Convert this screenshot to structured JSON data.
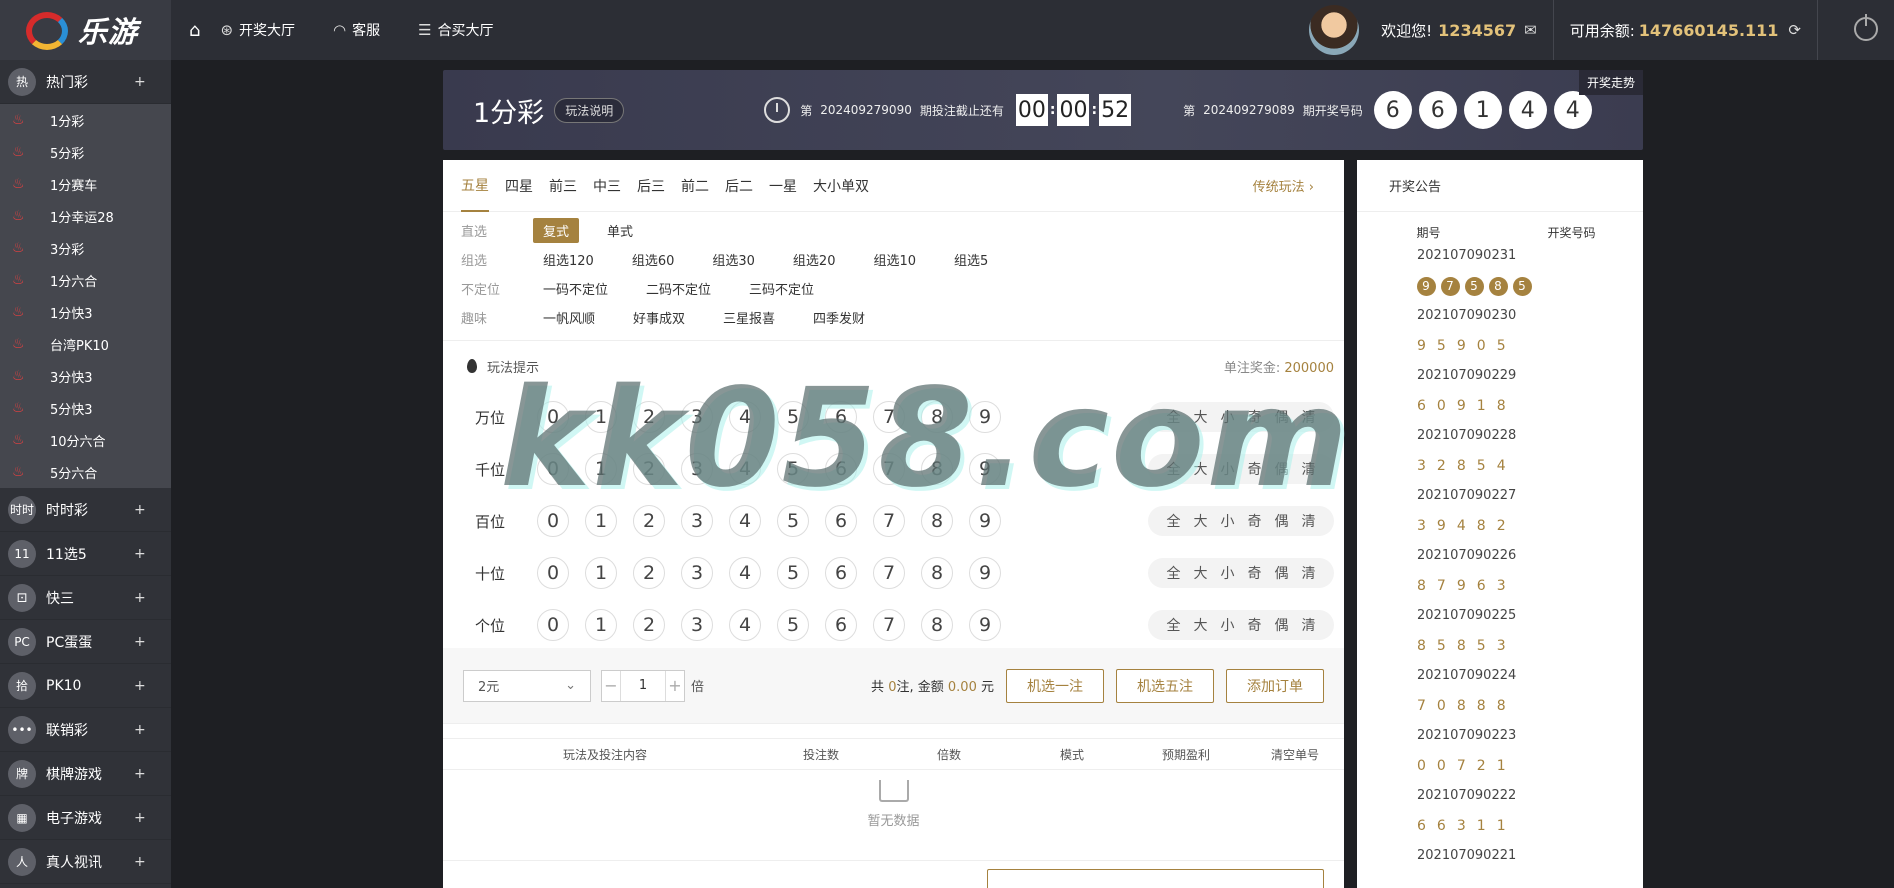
{
  "brand": {
    "name": "乐游"
  },
  "topnav": {
    "items": [
      {
        "label": "开奖大厅",
        "icon": "trophy-icon"
      },
      {
        "label": "客服",
        "icon": "headset-icon"
      },
      {
        "label": "合买大厅",
        "icon": "list-icon"
      }
    ]
  },
  "user": {
    "welcome": "欢迎您!",
    "name": "1234567",
    "balance_label": "可用余额:",
    "balance": "147660145.111"
  },
  "sidebar": {
    "hot": {
      "label": "热门彩",
      "expand": "+",
      "items": [
        "1分彩",
        "5分彩",
        "1分赛车",
        "1分幸运28",
        "3分彩",
        "1分六合",
        "1分快3",
        "台湾PK10",
        "3分快3",
        "5分快3",
        "10分六合",
        "5分六合"
      ]
    },
    "categories": [
      {
        "label": "时时彩",
        "icon_text": "时时",
        "expand": "+"
      },
      {
        "label": "11选5",
        "icon_text": "11",
        "expand": "+"
      },
      {
        "label": "快三",
        "icon_text": "⚀",
        "expand": "+"
      },
      {
        "label": "PC蛋蛋",
        "icon_text": "PC",
        "expand": "+"
      },
      {
        "label": "PK10",
        "icon_text": "拾",
        "expand": "+"
      },
      {
        "label": "联销彩",
        "icon_text": "•••",
        "expand": "+"
      },
      {
        "label": "棋牌游戏",
        "icon_text": "牌",
        "expand": "+"
      },
      {
        "label": "电子游戏",
        "icon_text": "▦",
        "expand": "+"
      },
      {
        "label": "真人视讯",
        "icon_text": "人",
        "expand": "+"
      }
    ]
  },
  "banner": {
    "game_name": "1分彩",
    "rule_label": "玩法说明",
    "current_prefix": "第",
    "current_issue": "202409279090",
    "deadline_text": "期投注截止还有",
    "countdown": [
      "00",
      "00",
      "52"
    ],
    "last_prefix": "第",
    "last_issue": "202409279089",
    "last_text": "期开奖号码",
    "last_numbers": [
      "6",
      "6",
      "1",
      "4",
      "4"
    ],
    "trend_label": "开奖走势"
  },
  "tabs": {
    "items": [
      "五星",
      "四星",
      "前三",
      "中三",
      "后三",
      "前二",
      "后二",
      "一星",
      "大小单双"
    ],
    "active": 0,
    "traditional": "传统玩法 ›"
  },
  "methods": [
    {
      "label": "直选",
      "options": [
        "复式",
        "单式"
      ],
      "selected": 0
    },
    {
      "label": "组选",
      "options": [
        "组选120",
        "组选60",
        "组选30",
        "组选20",
        "组选10",
        "组选5"
      ],
      "selected": -1
    },
    {
      "label": "不定位",
      "options": [
        "一码不定位",
        "二码不定位",
        "三码不定位"
      ],
      "selected": -1
    },
    {
      "label": "趣味",
      "options": [
        "一帆风顺",
        "好事成双",
        "三星报喜",
        "四季发财"
      ],
      "selected": -1
    }
  ],
  "hint": {
    "label": "玩法提示",
    "prize_label": "单注奖金:",
    "prize_value": "200000"
  },
  "positions": [
    "万位",
    "千位",
    "百位",
    "十位",
    "个位"
  ],
  "digits": [
    "0",
    "1",
    "2",
    "3",
    "4",
    "5",
    "6",
    "7",
    "8",
    "9"
  ],
  "quick": [
    "全",
    "大",
    "小",
    "奇",
    "偶",
    "清"
  ],
  "betbar": {
    "unit": "2元",
    "multiple": "1",
    "times_label": "倍",
    "sum_prefix": "共",
    "sum_count": "0",
    "sum_mid": "注, 金额",
    "sum_amount": "0.00",
    "sum_unit": "元",
    "buttons": [
      "机选一注",
      "机选五注",
      "添加订单"
    ]
  },
  "order_head": [
    "玩法及投注内容",
    "投注数",
    "倍数",
    "模式",
    "预期盈利",
    "清空单号"
  ],
  "empty_text": "暂无数据",
  "results": {
    "title": "开奖公告",
    "col_issue": "期号",
    "col_numbers": "开奖号码",
    "rows": [
      {
        "issue": "202107090231",
        "numbers": [
          "9",
          "7",
          "5",
          "8",
          "5"
        ]
      },
      {
        "issue": "202107090230",
        "numbers": [
          "9",
          "5",
          "9",
          "0",
          "5"
        ]
      },
      {
        "issue": "202107090229",
        "numbers": [
          "6",
          "0",
          "9",
          "1",
          "8"
        ]
      },
      {
        "issue": "202107090228",
        "numbers": [
          "3",
          "2",
          "8",
          "5",
          "4"
        ]
      },
      {
        "issue": "202107090227",
        "numbers": [
          "3",
          "9",
          "4",
          "8",
          "2"
        ]
      },
      {
        "issue": "202107090226",
        "numbers": [
          "8",
          "7",
          "9",
          "6",
          "3"
        ]
      },
      {
        "issue": "202107090225",
        "numbers": [
          "8",
          "5",
          "8",
          "5",
          "3"
        ]
      },
      {
        "issue": "202107090224",
        "numbers": [
          "7",
          "0",
          "8",
          "8",
          "8"
        ]
      },
      {
        "issue": "202107090223",
        "numbers": [
          "0",
          "0",
          "7",
          "2",
          "1"
        ]
      },
      {
        "issue": "202107090222",
        "numbers": [
          "6",
          "6",
          "3",
          "1",
          "1"
        ]
      },
      {
        "issue": "202107090221",
        "numbers": []
      }
    ]
  },
  "watermark": "kk058.com",
  "colors": {
    "accent": "#a5823f",
    "gold": "#e3c27a",
    "fire": "#e84040",
    "topbar": "#2c2e35",
    "sidebar": "#303238"
  }
}
